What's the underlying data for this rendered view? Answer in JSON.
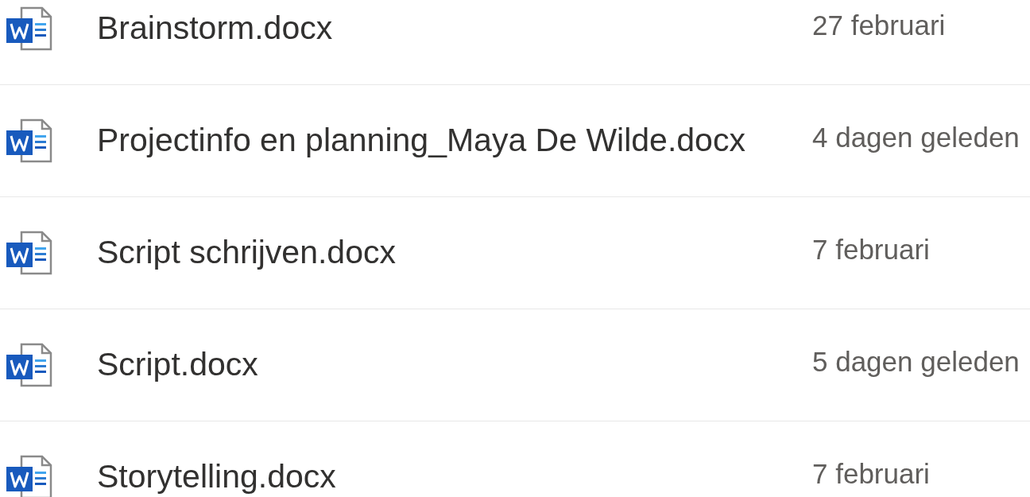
{
  "files": [
    {
      "name": "Brainstorm.docx",
      "modified": "27 februari"
    },
    {
      "name": "Projectinfo en planning_Maya De Wilde.docx",
      "modified": "4 dagen geleden"
    },
    {
      "name": "Script schrijven.docx",
      "modified": "7 februari"
    },
    {
      "name": "Script.docx",
      "modified": "5 dagen geleden"
    },
    {
      "name": "Storytelling.docx",
      "modified": "7 februari"
    }
  ]
}
